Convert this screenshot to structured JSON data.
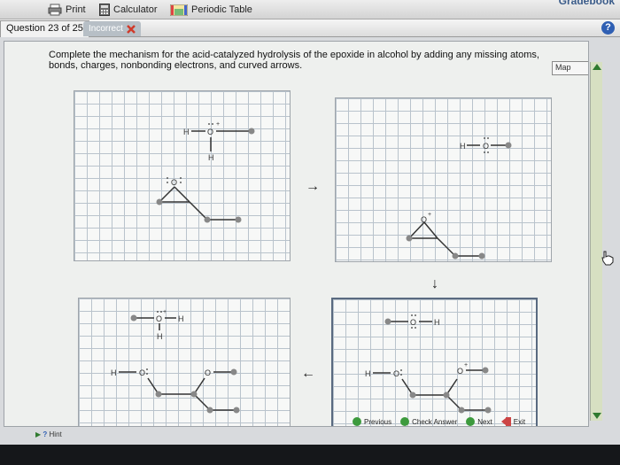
{
  "toolbar": {
    "print_label": "Print",
    "calculator_label": "Calculator",
    "periodic_table_label": "Periodic Table",
    "gradebook_label": "Gradebook"
  },
  "question": {
    "counter": "Question 23 of 25",
    "status": "Incorrect"
  },
  "instructions": "Complete the mechanism for the acid-catalyzed hydrolysis of the epoxide in alcohol by adding any missing atoms, bonds, charges, nonbonding electrons, and curved arrows.",
  "map_label": "Map",
  "help_label": "?",
  "panels": {
    "p1": {
      "h_left": "H",
      "o_plus": "O",
      "h_below": "H",
      "o_epoxide": "O"
    },
    "p2": {
      "h_left": "H",
      "o_alcohol": "O",
      "o_plus": "O"
    },
    "p3": {
      "o_plus": "O",
      "h_right": "H",
      "h_below": "H",
      "h_left": "H",
      "o_free": "O",
      "o_chain": "O"
    },
    "p4": {
      "h_right": "H",
      "h_left": "H",
      "o_free": "O",
      "o_chain": "O"
    }
  },
  "arrows": {
    "right": "→",
    "down": "↓",
    "left": "←"
  },
  "nav": {
    "previous": "Previous",
    "check": "Check Answer",
    "next": "Next",
    "exit": "Exit"
  },
  "hint_label": "Hint",
  "colors": {
    "accent": "#2f5fb3",
    "incorrect": "#d03a2a",
    "nav_green": "#3d9a3d",
    "grid": "#b9c3cc"
  }
}
